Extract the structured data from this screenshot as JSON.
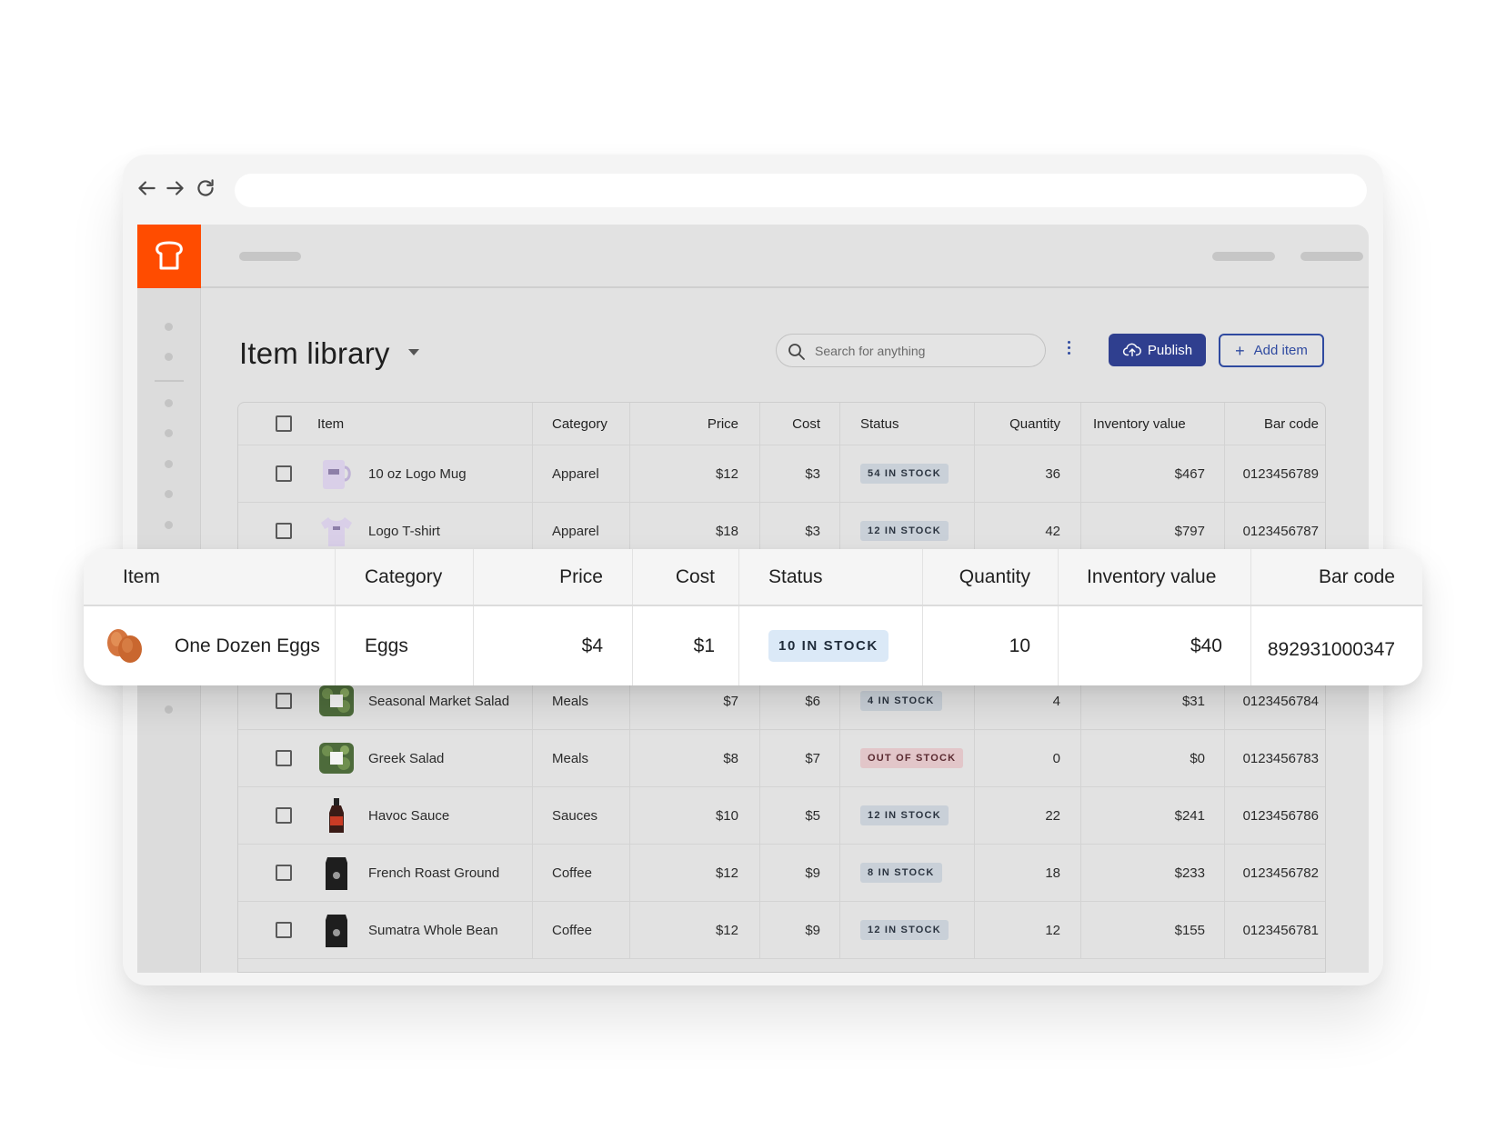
{
  "colors": {
    "brand": "#ff4c00",
    "primary": "#2f3f8f",
    "badge_in_stock": "#c9d0d8",
    "badge_out_of_stock": "#e2c6c9"
  },
  "page": {
    "title": "Item library"
  },
  "search": {
    "placeholder": "Search for anything"
  },
  "toolbar": {
    "publish_label": "Publish",
    "add_label": "Add item",
    "add_icon": "+"
  },
  "table": {
    "headers": {
      "item": "Item",
      "category": "Category",
      "price": "Price",
      "cost": "Cost",
      "status": "Status",
      "quantity": "Quantity",
      "inventory_value": "Inventory value",
      "bar_code": "Bar code"
    },
    "rows": [
      {
        "name": "10 oz Logo Mug",
        "category": "Apparel",
        "price": "$12",
        "cost": "$3",
        "status": "54 IN STOCK",
        "quantity": "36",
        "inventory_value": "$467",
        "bar_code": "0123456789",
        "thumb": "mug"
      },
      {
        "name": "Logo T-shirt",
        "category": "Apparel",
        "price": "$18",
        "cost": "$3",
        "status": "12 IN STOCK",
        "quantity": "42",
        "inventory_value": "$797",
        "bar_code": "0123456787",
        "thumb": "tshirt"
      },
      {
        "name": "Seasonal Market Salad",
        "category": "Meals",
        "price": "$7",
        "cost": "$6",
        "status": "4 IN STOCK",
        "quantity": "4",
        "inventory_value": "$31",
        "bar_code": "0123456784",
        "thumb": "salad"
      },
      {
        "name": "Greek Salad",
        "category": "Meals",
        "price": "$8",
        "cost": "$7",
        "status": "OUT OF STOCK",
        "quantity": "0",
        "inventory_value": "$0",
        "bar_code": "0123456783",
        "thumb": "salad"
      },
      {
        "name": "Havoc Sauce",
        "category": "Sauces",
        "price": "$10",
        "cost": "$5",
        "status": "12 IN STOCK",
        "quantity": "22",
        "inventory_value": "$241",
        "bar_code": "0123456786",
        "thumb": "sauce"
      },
      {
        "name": "French Roast Ground",
        "category": "Coffee",
        "price": "$12",
        "cost": "$9",
        "status": "8 IN STOCK",
        "quantity": "18",
        "inventory_value": "$233",
        "bar_code": "0123456782",
        "thumb": "coffee"
      },
      {
        "name": "Sumatra Whole Bean",
        "category": "Coffee",
        "price": "$12",
        "cost": "$9",
        "status": "12 IN STOCK",
        "quantity": "12",
        "inventory_value": "$155",
        "bar_code": "0123456781",
        "thumb": "coffee"
      }
    ]
  },
  "highlight": {
    "headers": {
      "item": "Item",
      "category": "Category",
      "price": "Price",
      "cost": "Cost",
      "status": "Status",
      "quantity": "Quantity",
      "inventory_value": "Inventory value",
      "bar_code": "Bar code"
    },
    "row": {
      "name": "One Dozen Eggs",
      "category": "Eggs",
      "price": "$4",
      "cost": "$1",
      "status": "10 IN STOCK",
      "quantity": "10",
      "inventory_value": "$40",
      "bar_code": "892931000347",
      "thumb": "eggs"
    }
  }
}
